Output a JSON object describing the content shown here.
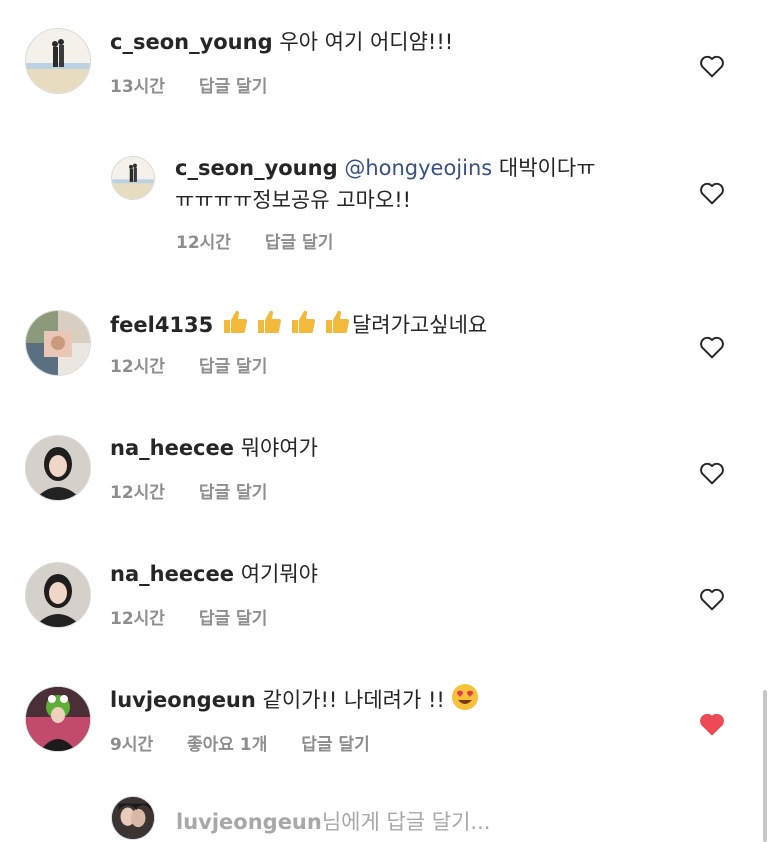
{
  "comments": [
    {
      "username": "c_seon_young",
      "text": "우아 여기 어디얌!!!",
      "time": "13시간",
      "reply": "답글 달기",
      "liked": false
    },
    {
      "username": "c_seon_young",
      "mention": "@hongyeojins",
      "text_line1": "대박이다ㅠ",
      "text_line2": "ㅠㅠㅠㅠ정보공유 고마오!!",
      "time": "12시간",
      "reply": "답글 달기",
      "liked": false
    },
    {
      "username": "feel4135",
      "text": "달려가고싶네요",
      "time": "12시간",
      "reply": "답글 달기",
      "liked": false
    },
    {
      "username": "na_heecee",
      "text": "뭐야여가",
      "time": "12시간",
      "reply": "답글 달기",
      "liked": false
    },
    {
      "username": "na_heecee",
      "text": "여기뭐야",
      "time": "12시간",
      "reply": "답글 달기",
      "liked": false
    },
    {
      "username": "luvjeongeun",
      "text": "같이가!! 나데려가 !!",
      "time": "9시간",
      "likes": "좋아요 1개",
      "reply": "답글 달기",
      "liked": true
    }
  ],
  "reply_input": {
    "username": "luvjeongeun",
    "suffix": "님에게 답글 달기..."
  },
  "colors": {
    "mention": "#385185",
    "liked_heart": "#ed4956",
    "meta": "#8e8e8e"
  }
}
